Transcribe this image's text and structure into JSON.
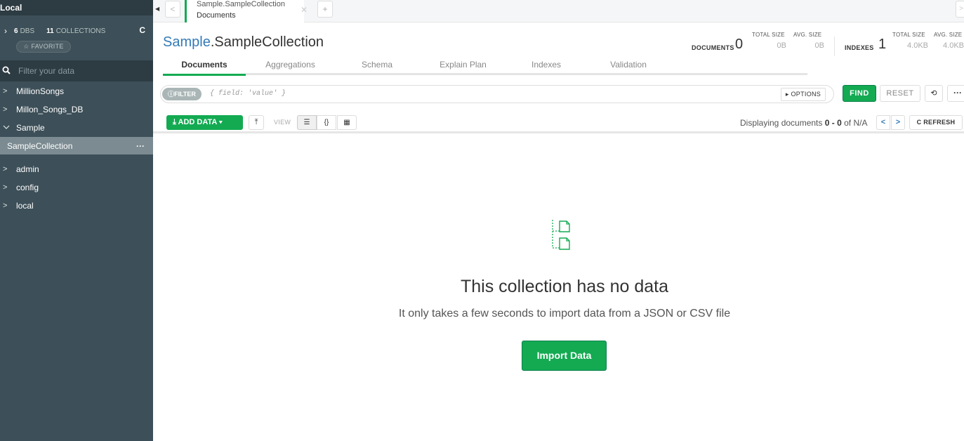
{
  "sidebar": {
    "title": "Local",
    "dbs_count": "6",
    "dbs_label": "DBS",
    "collections_count": "11",
    "collections_label": "COLLECTIONS",
    "refresh_icon": "C",
    "favorite_label": "☆ FAVORITE",
    "filter_placeholder": "Filter your data",
    "databases": [
      {
        "name": "MillionSongs",
        "expanded": false
      },
      {
        "name": "Millon_Songs_DB",
        "expanded": false
      },
      {
        "name": "Sample",
        "expanded": true
      },
      {
        "name": "admin",
        "expanded": false
      },
      {
        "name": "config",
        "expanded": false
      },
      {
        "name": "local",
        "expanded": false
      }
    ],
    "selected_collection": "SampleCollection",
    "selected_collection_menu": "···"
  },
  "tabs": {
    "active_title": "Sample.SampleCollection",
    "active_subtitle": "Documents"
  },
  "header": {
    "db_name": "Sample",
    "coll_name": ".SampleCollection",
    "documents_label": "DOCUMENTS",
    "documents_count": "0",
    "doc_total_size_label": "TOTAL SIZE",
    "doc_total_size": "0B",
    "doc_avg_size_label": "AVG. SIZE",
    "doc_avg_size": "0B",
    "indexes_label": "INDEXES",
    "indexes_count": "1",
    "idx_total_size_label": "TOTAL SIZE",
    "idx_total_size": "4.0KB",
    "idx_avg_size_label": "AVG. SIZE",
    "idx_avg_size": "4.0KB"
  },
  "subtabs": [
    "Documents",
    "Aggregations",
    "Schema",
    "Explain Plan",
    "Indexes",
    "Validation"
  ],
  "query": {
    "filter_label": "FILTER",
    "placeholder": "{ field: 'value' }",
    "options_label": "OPTIONS",
    "find_label": "FIND",
    "reset_label": "RESET",
    "more_label": "···"
  },
  "toolbar": {
    "add_data_label": "ADD DATA",
    "view_label": "VIEW",
    "displaying_prefix": "Displaying documents ",
    "range_start": "0",
    "range_sep": " - ",
    "range_end": "0",
    "of_label": " of N/A",
    "refresh_label": "REFRESH"
  },
  "empty_state": {
    "title": "This collection has no data",
    "subtitle": "It only takes a few seconds to import data from a JSON or CSV file",
    "import_button": "Import Data"
  },
  "colors": {
    "sidebar_bg": "#3d4f58",
    "accent_green": "#13aa52",
    "link_blue": "#337ab7"
  }
}
